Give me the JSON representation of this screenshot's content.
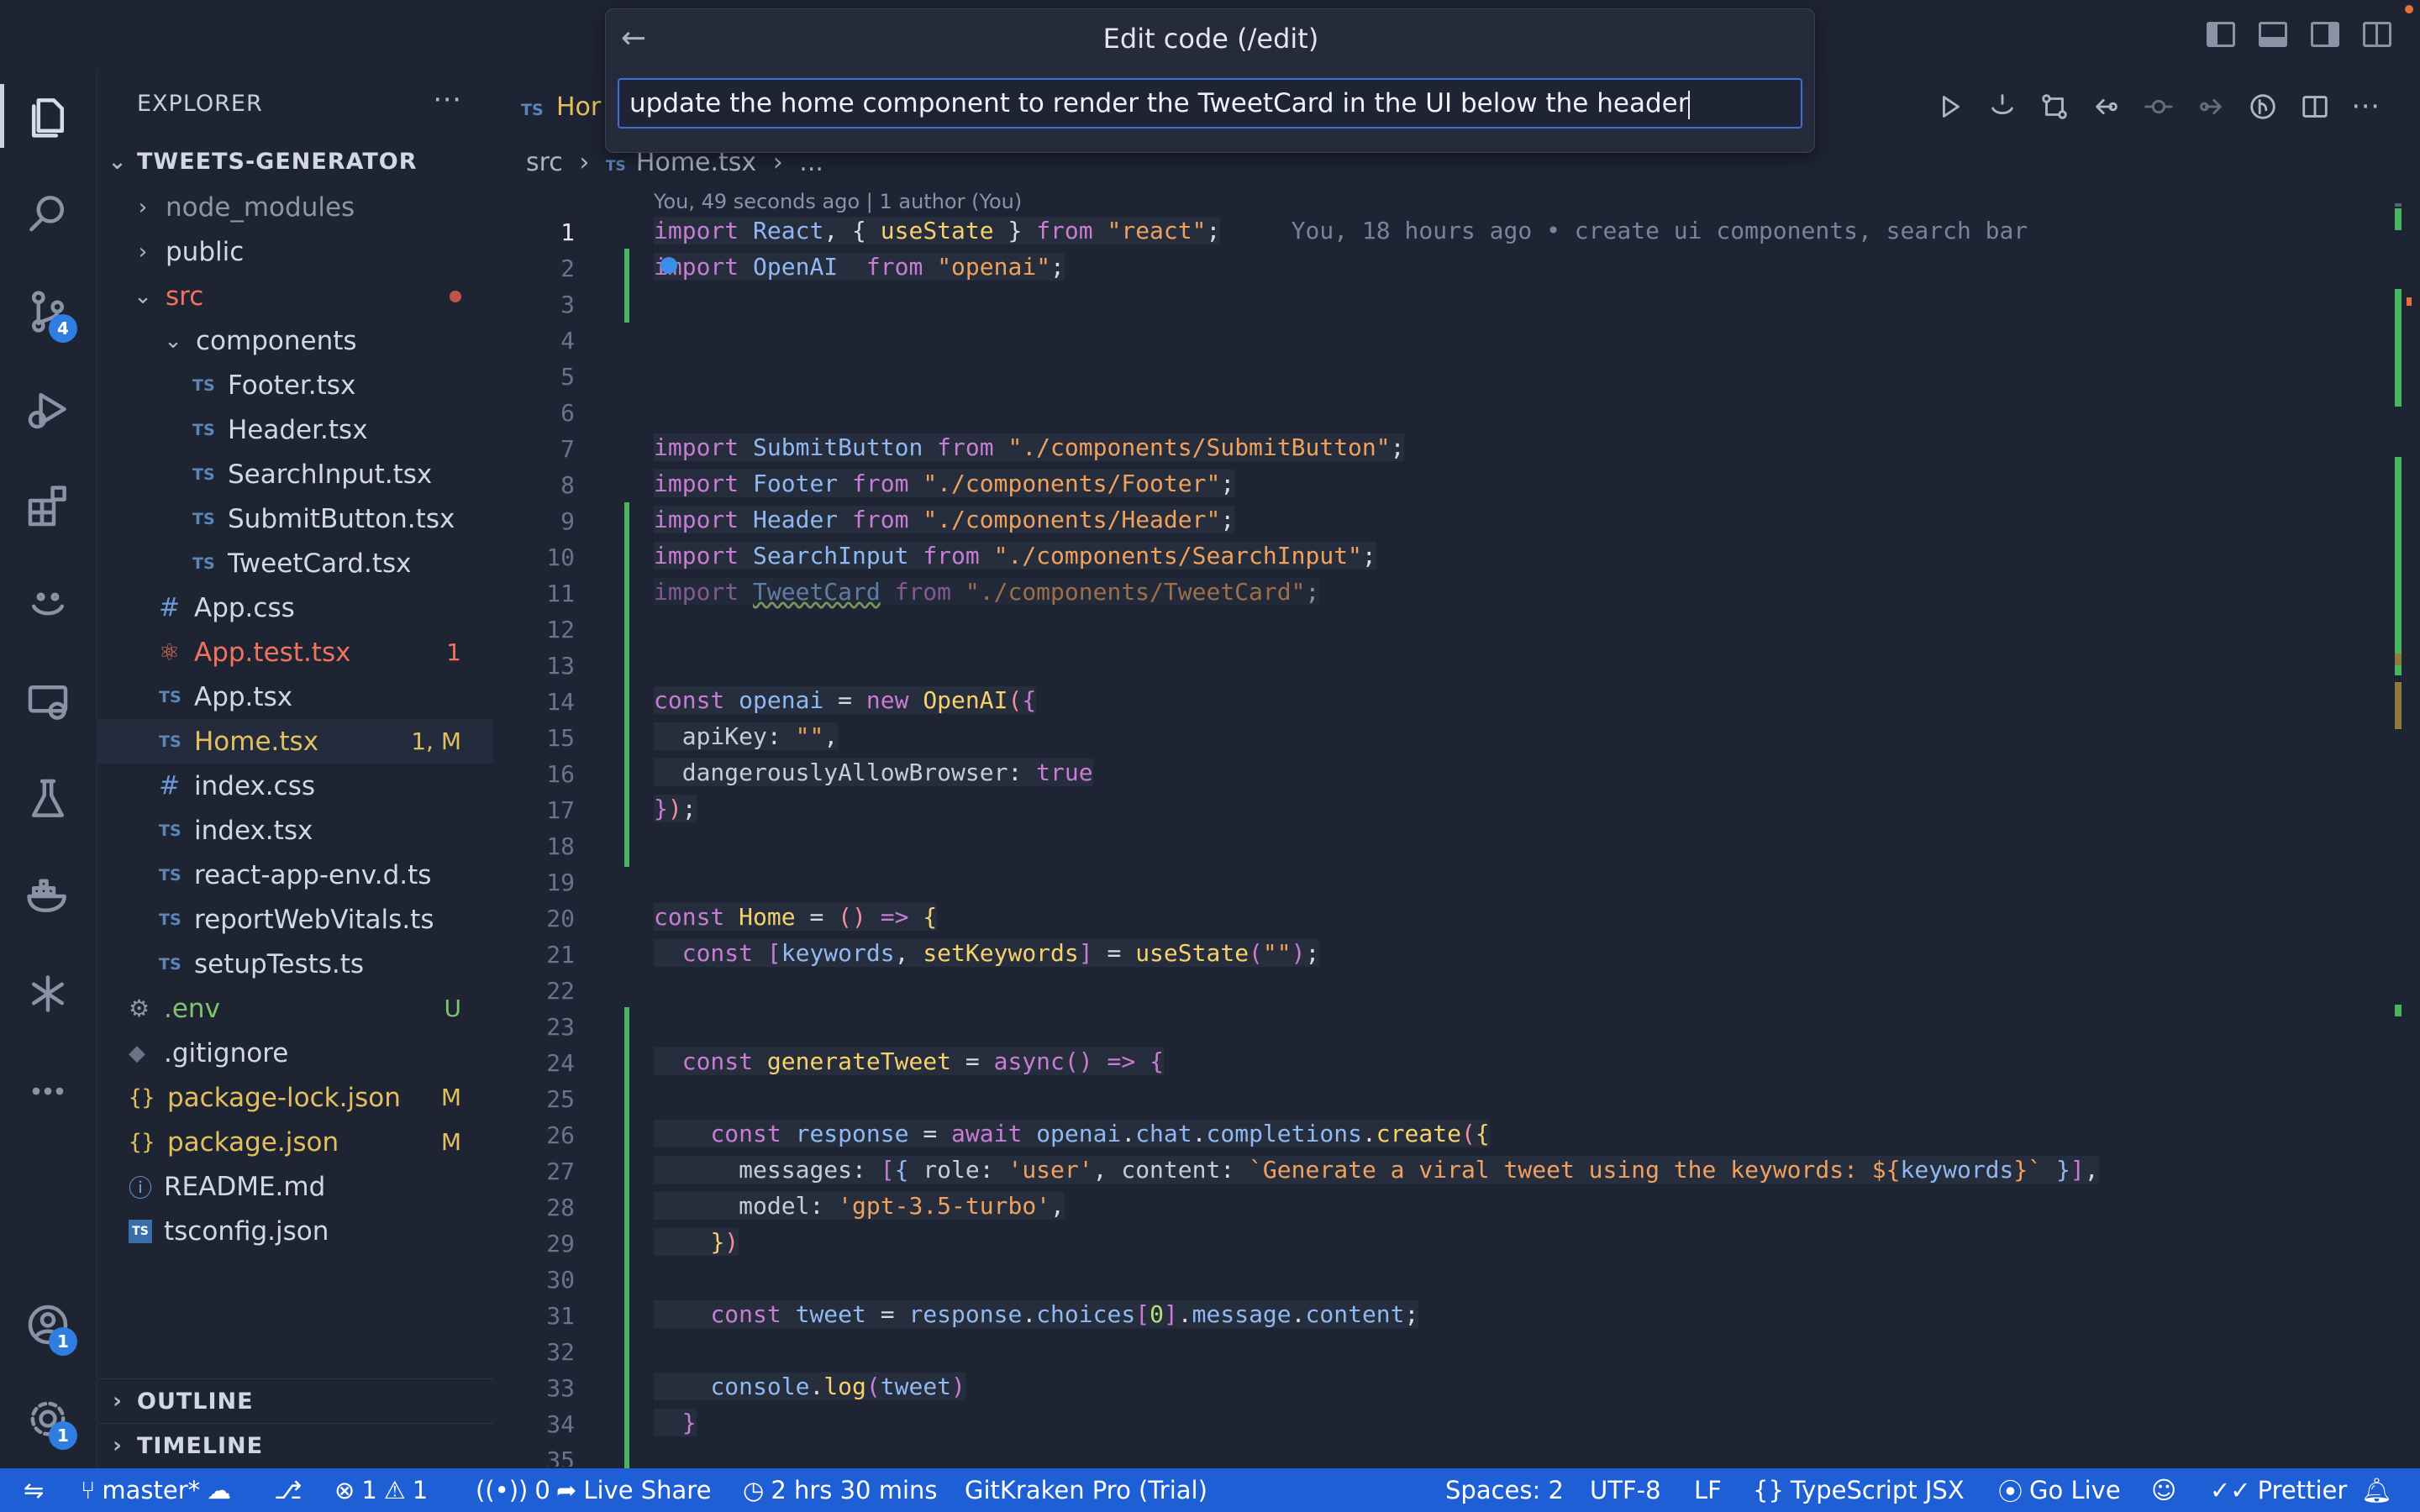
{
  "palette": {
    "title": "Edit code (/edit)",
    "input": "update the home component to render the TweetCard in the UI below the header"
  },
  "sidebar": {
    "title": "EXPLORER",
    "root": "TWEETS-GENERATOR",
    "items": [
      {
        "label": "node_modules"
      },
      {
        "label": "public"
      },
      {
        "label": "src"
      },
      {
        "label": "components"
      },
      {
        "label": "Footer.tsx"
      },
      {
        "label": "Header.tsx"
      },
      {
        "label": "SearchInput.tsx"
      },
      {
        "label": "SubmitButton.tsx"
      },
      {
        "label": "TweetCard.tsx"
      },
      {
        "label": "App.css"
      },
      {
        "label": "App.test.tsx",
        "status": "1"
      },
      {
        "label": "App.tsx"
      },
      {
        "label": "Home.tsx",
        "status": "1, M"
      },
      {
        "label": "index.css"
      },
      {
        "label": "index.tsx"
      },
      {
        "label": "react-app-env.d.ts"
      },
      {
        "label": "reportWebVitals.ts"
      },
      {
        "label": "setupTests.ts"
      },
      {
        "label": ".env",
        "status": "U"
      },
      {
        "label": ".gitignore"
      },
      {
        "label": "package-lock.json",
        "status": "M"
      },
      {
        "label": "package.json",
        "status": "M"
      },
      {
        "label": "README.md"
      },
      {
        "label": "tsconfig.json"
      }
    ],
    "outline": "OUTLINE",
    "timeline": "TIMELINE"
  },
  "activity": {
    "scm_badge": "4",
    "accounts_badge": "1",
    "settings_badge": "1"
  },
  "editor": {
    "tab_partial": "Hor",
    "breadcrumb": [
      "src",
      "Home.tsx",
      "..."
    ],
    "blame_header": "You, 49 seconds ago | 1 author (You)",
    "inline_blame": "You, 18 hours ago • create ui components, search bar",
    "line_numbers": [
      "1",
      "2",
      "3",
      "4",
      "5",
      "6",
      "7",
      "8",
      "9",
      "10",
      "11",
      "12",
      "13",
      "14",
      "15",
      "16",
      "17",
      "18",
      "19",
      "20",
      "21",
      "22",
      "23",
      "24",
      "25",
      "26",
      "27",
      "28",
      "29",
      "30",
      "31",
      "32",
      "33",
      "34",
      "35"
    ]
  },
  "statusbar": {
    "branch": "master*",
    "errors": "1",
    "warnings": "1",
    "ports": "0",
    "live_share": "Live Share",
    "time": "2 hrs 30 mins",
    "gitkraken": "GitKraken Pro (Trial)",
    "spaces": "Spaces: 2",
    "encoding": "UTF-8",
    "eol": "LF",
    "language": "TypeScript JSX",
    "go_live": "Go Live",
    "prettier": "Prettier"
  },
  "colors": {
    "accent": "#1f5fd6",
    "added_gutter": "#4ab561",
    "modified": "#e2c05d",
    "error": "#f0735e"
  }
}
